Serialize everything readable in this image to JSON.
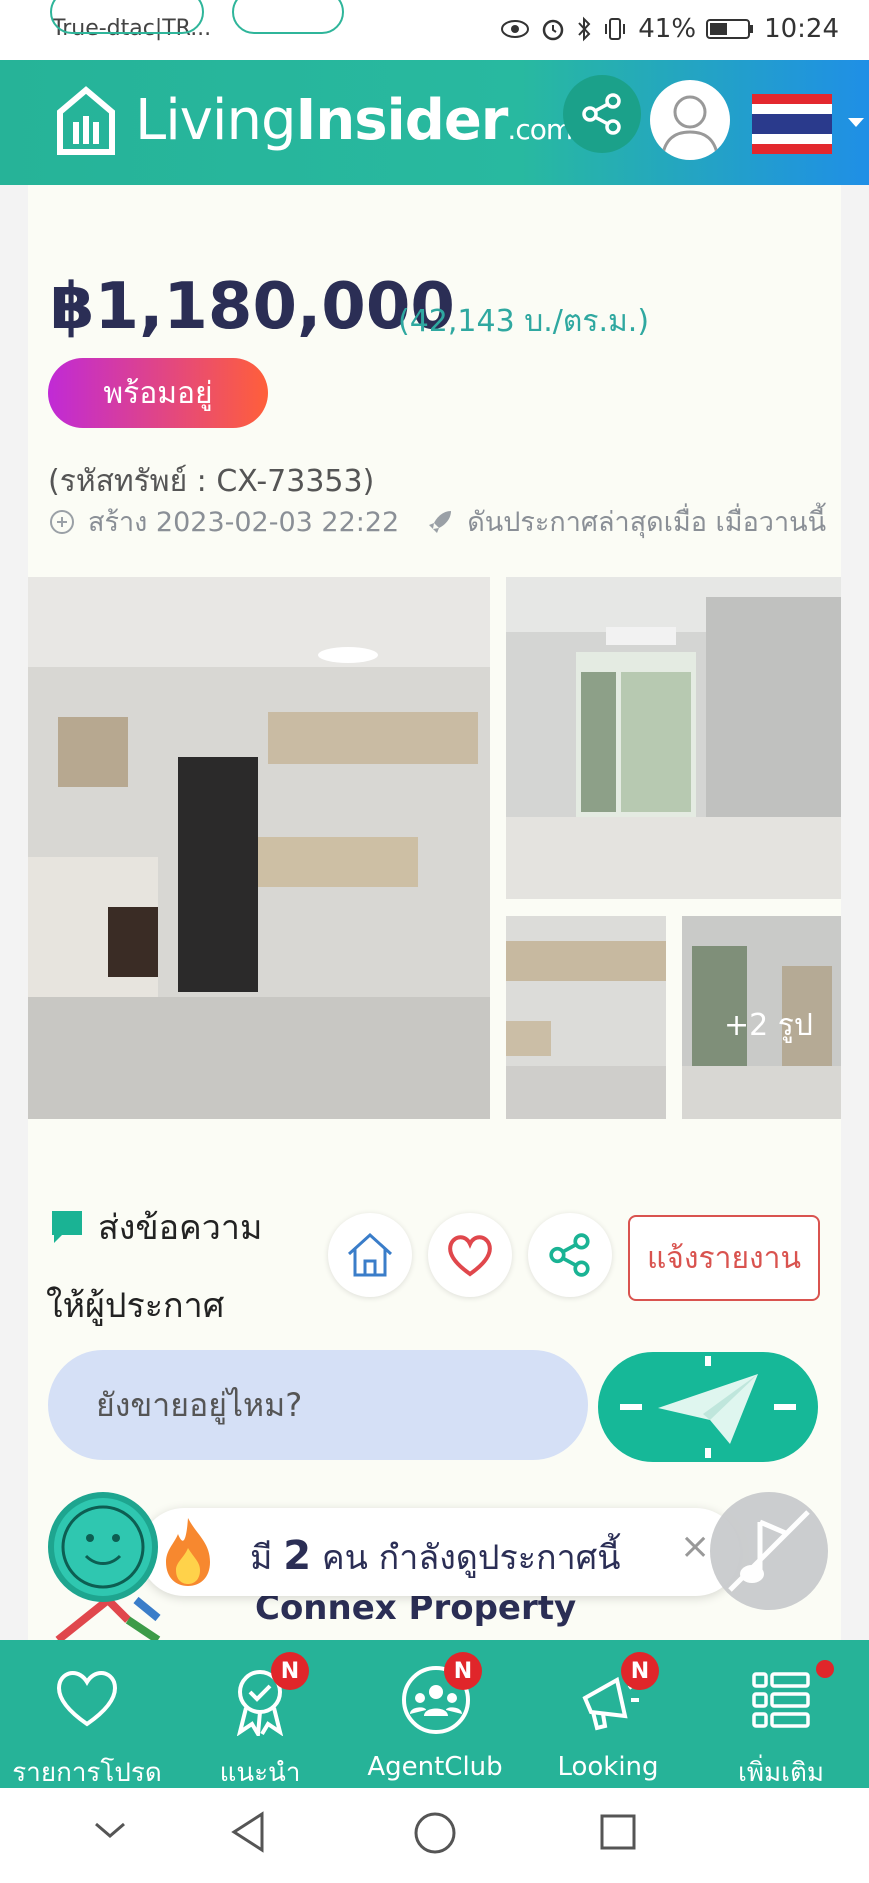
{
  "status_bar": {
    "carrier": "True-dtac|TR...",
    "battery": "41%",
    "time": "10:24"
  },
  "header": {
    "logo_living": "Living",
    "logo_insider": "Insider",
    "logo_com": ".com"
  },
  "listing": {
    "price": "฿1,180,000",
    "price_per_sqm": "(42,143 บ./ตร.ม.)",
    "status_badge": "พร้อมอยู่",
    "property_code": "(รหัสทรัพย์ : CX-73353)",
    "created": "สร้าง 2023-02-03 22:22",
    "boosted": "ดันประกาศล่าสุดเมื่อ เมื่อวานนี้",
    "more_photos": "+2 รูป"
  },
  "message": {
    "title": "ส่งข้อความ",
    "subtitle": "ให้ผู้ประกาศ",
    "report_label": "แจ้งรายงาน",
    "input_value": "ยังขายอยู่ไหม?"
  },
  "viewers": {
    "prefix": "มี",
    "count": "2",
    "suffix": "คน กำลังดูประกาศนี้",
    "close": "×"
  },
  "agent": {
    "name": "Connex Property"
  },
  "bottom_nav": {
    "items": [
      {
        "label": "รายการโปรด",
        "icon": "heart-icon"
      },
      {
        "label": "แนะนำ",
        "icon": "award-icon",
        "badge": "N"
      },
      {
        "label": "AgentClub",
        "icon": "group-icon",
        "badge": "N"
      },
      {
        "label": "Looking",
        "icon": "megaphone-icon",
        "badge": "N"
      },
      {
        "label": "เพิ่มเติม",
        "icon": "menu-list-icon"
      }
    ]
  },
  "colors": {
    "brand_green": "#26b398",
    "price_navy": "#2b2e55",
    "report_red": "#d9534f"
  }
}
